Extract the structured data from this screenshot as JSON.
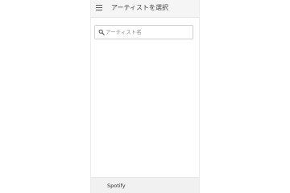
{
  "appbar": {
    "menu_icon": "hamburger-menu-icon",
    "title": "アーティストを選択"
  },
  "search": {
    "icon": "search-icon",
    "placeholder": "アーティスト名",
    "value": ""
  },
  "footer": {
    "label": "Spotify"
  },
  "colors": {
    "appbar_bg": "#f5f5f5",
    "footer_bg": "#f1f1f1",
    "text": "#444444",
    "border": "#cfcfcf"
  }
}
